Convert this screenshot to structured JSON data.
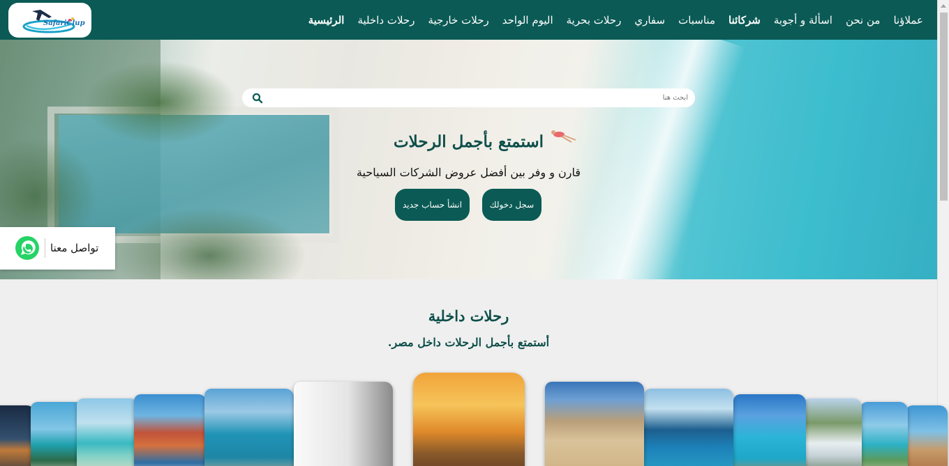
{
  "header": {
    "logo_text": "SafariClup",
    "nav": [
      {
        "label": "الرئيسية",
        "active": true
      },
      {
        "label": "رحلات داخلية",
        "active": false
      },
      {
        "label": "رحلات خارجية",
        "active": false
      },
      {
        "label": "اليوم الواحد",
        "active": false
      },
      {
        "label": "رحلات بحرية",
        "active": false
      },
      {
        "label": "سفاري",
        "active": false
      },
      {
        "label": "مناسبات",
        "active": false
      },
      {
        "label": "شركائنا",
        "active": true
      },
      {
        "label": "اسألة و أجوبة",
        "active": false
      },
      {
        "label": "من نحن",
        "active": false
      },
      {
        "label": "عملاؤنا",
        "active": false
      }
    ]
  },
  "hero": {
    "search_placeholder": "أبحث هنا",
    "title": "استمتع بأجمل الرحلات",
    "subtitle": "قارن و وفر بين أفضل عروض الشركات السياحية",
    "login_label": "سجل دخولك",
    "register_label": "انشأ حساب جديد"
  },
  "contact": {
    "label": "تواصل معنا",
    "icon": "whatsapp-icon"
  },
  "section": {
    "title": "رحلات داخلية",
    "subtitle": "أستمتع بأجمل الرحلات داخل مصر."
  },
  "colors": {
    "brand": "#0b5a55",
    "heading": "#0d4f4a",
    "whatsapp": "#25d366",
    "background": "#efefef"
  },
  "carousel": {
    "cards": [
      {
        "name": "trip-card-night-marina",
        "theme": "night"
      },
      {
        "name": "trip-card-palm-beach",
        "theme": "palm"
      },
      {
        "name": "trip-card-lagoon",
        "theme": "lagoon"
      },
      {
        "name": "trip-card-harbor",
        "theme": "harbor"
      },
      {
        "name": "trip-card-coast",
        "theme": "coast"
      },
      {
        "name": "trip-card-placeholder",
        "theme": "blank"
      },
      {
        "name": "trip-card-temple-sunset",
        "theme": "temple"
      },
      {
        "name": "trip-card-desert-camp",
        "theme": "camp"
      },
      {
        "name": "trip-card-cliff-sea",
        "theme": "cliff"
      },
      {
        "name": "trip-card-pier",
        "theme": "pier"
      },
      {
        "name": "trip-card-waterfall",
        "theme": "waterfall"
      },
      {
        "name": "trip-card-resort",
        "theme": "resort"
      },
      {
        "name": "trip-card-umbrellas",
        "theme": "umbrellas"
      }
    ]
  }
}
